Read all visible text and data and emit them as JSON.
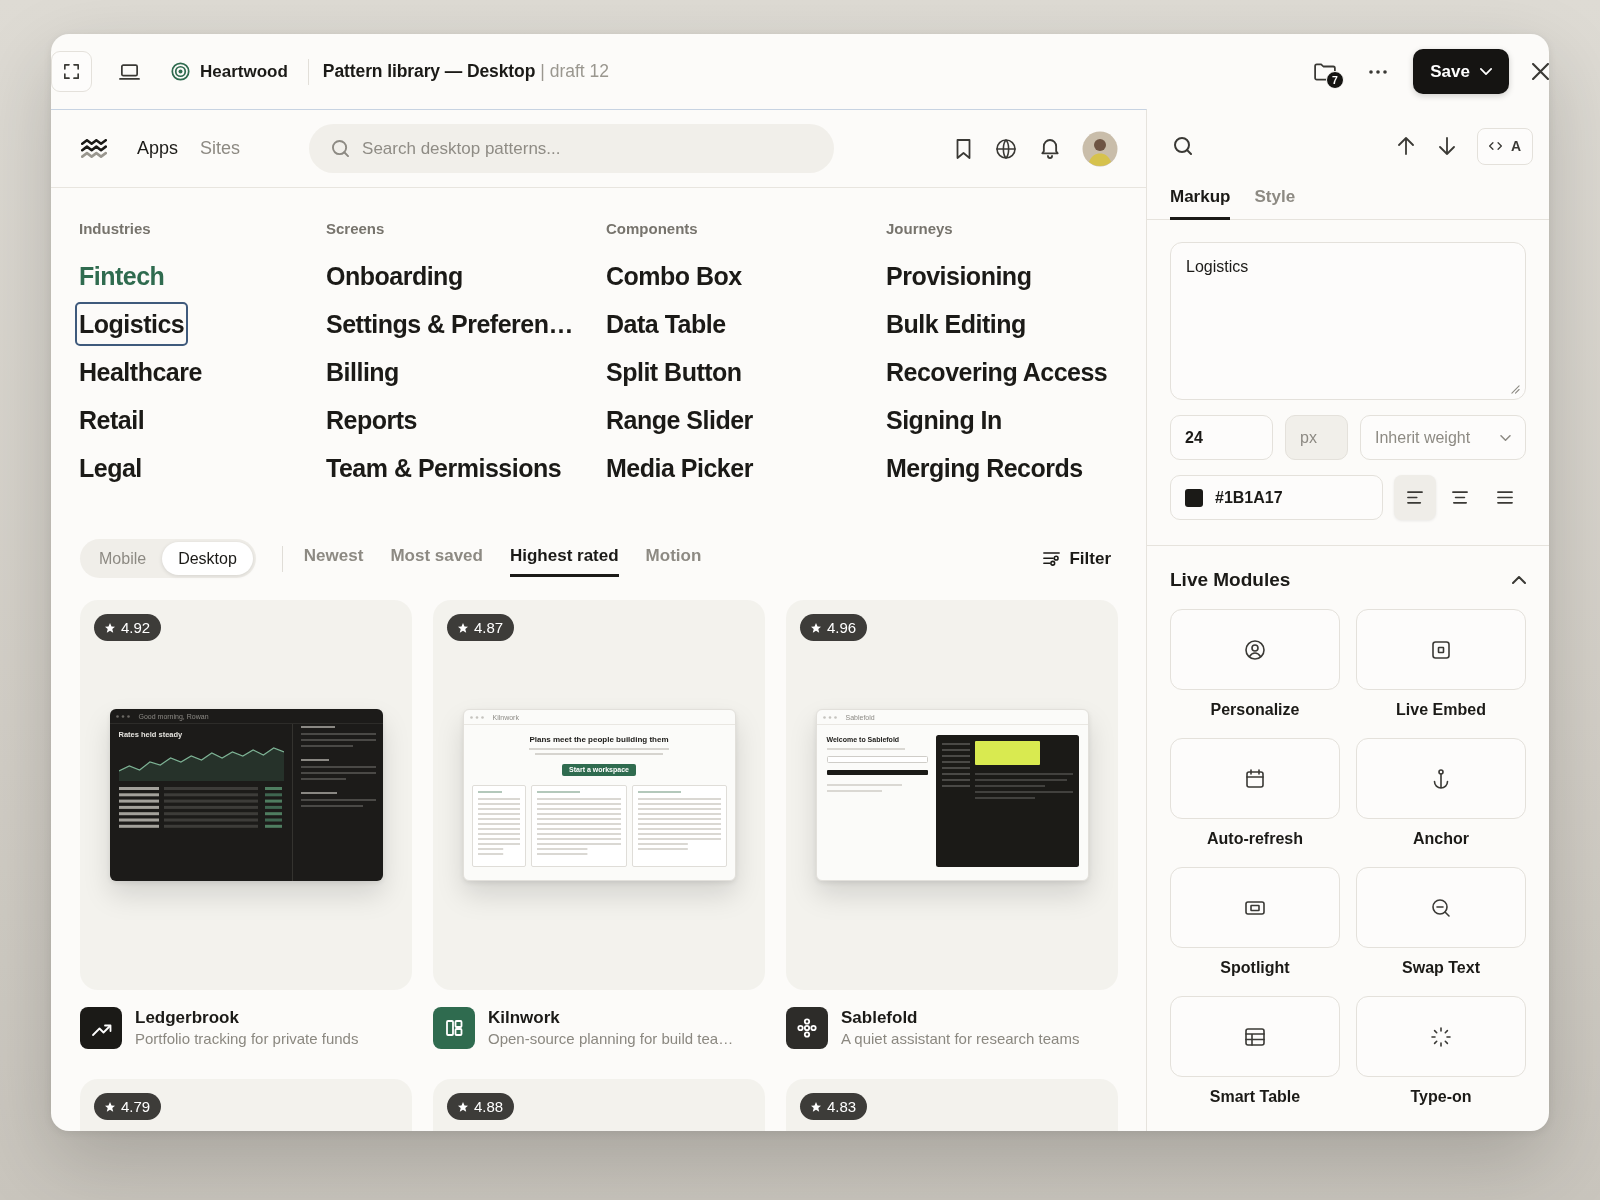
{
  "window": {
    "brand": "Heartwood",
    "title": "Pattern library — Desktop",
    "draft": "| draft 12",
    "folder_count": "7",
    "save": "Save"
  },
  "nav": {
    "tabs": [
      {
        "label": "Apps",
        "selected": true
      },
      {
        "label": "Sites",
        "selected": false
      }
    ],
    "search": {
      "placeholder": "Search desktop patterns..."
    }
  },
  "categories": [
    {
      "heading": "Industries",
      "items": [
        {
          "label": "Fintech",
          "selected": true,
          "editing": false
        },
        {
          "label": "Logistics",
          "selected": false,
          "editing": true
        },
        {
          "label": "Healthcare",
          "selected": false,
          "editing": false
        },
        {
          "label": "Retail",
          "selected": false,
          "editing": false
        },
        {
          "label": "Legal",
          "selected": false,
          "editing": false
        }
      ]
    },
    {
      "heading": "Screens",
      "items": [
        {
          "label": "Onboarding",
          "selected": false,
          "editing": false
        },
        {
          "label": "Settings & Preferen…",
          "selected": false,
          "editing": false
        },
        {
          "label": "Billing",
          "selected": false,
          "editing": false
        },
        {
          "label": "Reports",
          "selected": false,
          "editing": false
        },
        {
          "label": "Team & Permissions",
          "selected": false,
          "editing": false
        }
      ]
    },
    {
      "heading": "Components",
      "items": [
        {
          "label": "Combo Box",
          "selected": false,
          "editing": false
        },
        {
          "label": "Data Table",
          "selected": false,
          "editing": false
        },
        {
          "label": "Split Button",
          "selected": false,
          "editing": false
        },
        {
          "label": "Range Slider",
          "selected": false,
          "editing": false
        },
        {
          "label": "Media Picker",
          "selected": false,
          "editing": false
        }
      ]
    },
    {
      "heading": "Journeys",
      "items": [
        {
          "label": "Provisioning",
          "selected": false,
          "editing": false
        },
        {
          "label": "Bulk Editing",
          "selected": false,
          "editing": false
        },
        {
          "label": "Recovering Access",
          "selected": false,
          "editing": false
        },
        {
          "label": "Signing In",
          "selected": false,
          "editing": false
        },
        {
          "label": "Merging Records",
          "selected": false,
          "editing": false
        }
      ]
    }
  ],
  "filters": {
    "devices": [
      {
        "label": "Mobile",
        "selected": false
      },
      {
        "label": "Desktop",
        "selected": true
      }
    ],
    "sorts": [
      {
        "label": "Newest",
        "selected": false
      },
      {
        "label": "Most saved",
        "selected": false
      },
      {
        "label": "Highest rated",
        "selected": true
      },
      {
        "label": "Motion",
        "selected": false
      }
    ],
    "filter": "Filter"
  },
  "cards": [
    {
      "rating": "4.92",
      "kind": "dashboard",
      "preview": {
        "window_title": "Good morning, Rowan",
        "heading": "Rates held steady"
      },
      "name": "Ledgerbrook",
      "description": "Portfolio tracking for private funds",
      "color": "#1b1a17"
    },
    {
      "rating": "4.87",
      "kind": "landing",
      "preview": {
        "window_title": "Kilnwork",
        "heading": "Plans meet the people building them",
        "button": "Start a workspace"
      },
      "name": "Kilnwork",
      "description": "Open-source planning for build tea…",
      "color": "#2f6b4f"
    },
    {
      "rating": "4.96",
      "kind": "split",
      "preview": {
        "window_title": "Sablefold",
        "heading": "Welcome to Sablefold"
      },
      "name": "Sablefold",
      "description": "A quiet assistant for research teams",
      "color": "#2d2c29"
    },
    {
      "rating": "4.79"
    },
    {
      "rating": "4.88"
    },
    {
      "rating": "4.83"
    }
  ],
  "inspector": {
    "mode": "A",
    "tabs": [
      {
        "label": "Markup",
        "selected": true
      },
      {
        "label": "Style",
        "selected": false
      }
    ],
    "text": "Logistics",
    "size": "24",
    "unit": "px",
    "weight": "Inherit weight",
    "color": "#1B1A17",
    "align": [
      {
        "kind": "left",
        "selected": true
      },
      {
        "kind": "center",
        "selected": false
      },
      {
        "kind": "justify",
        "selected": false
      }
    ]
  },
  "modules": {
    "title": "Live Modules",
    "expanded": true,
    "items": [
      {
        "label": "Personalize",
        "kind": "person"
      },
      {
        "label": "Live Embed",
        "kind": "embed"
      },
      {
        "label": "Auto-refresh",
        "kind": "calendar"
      },
      {
        "label": "Anchor",
        "kind": "anchor"
      },
      {
        "label": "Spotlight",
        "kind": "frame"
      },
      {
        "label": "Swap Text",
        "kind": "zoom"
      },
      {
        "label": "Smart Table",
        "kind": "table"
      },
      {
        "label": "Type-on",
        "kind": "loader"
      }
    ]
  }
}
